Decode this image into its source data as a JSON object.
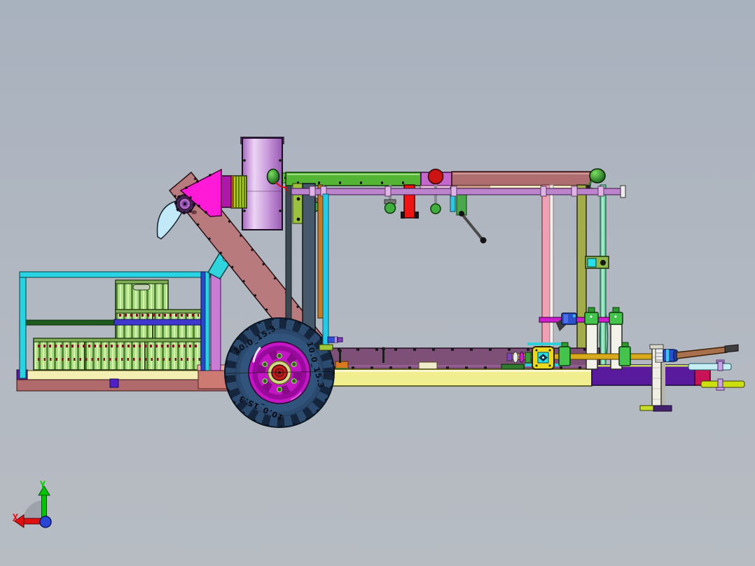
{
  "viewport": {
    "background_top": "#a8b1be",
    "background_mid": "#b2b8c1",
    "background_bottom": "#b7bcc3"
  },
  "orientation_triad": {
    "x_label": "X",
    "y_label": "Y",
    "x_axis_color": "#e81212",
    "y_axis_color": "#00d400",
    "z_axis_color": "#2a46d4"
  },
  "wheel": {
    "tire_marking": "10.0_15.3"
  },
  "model": {
    "colors": {
      "tire": "#2b4a6e",
      "tread": "#15253c",
      "rim": "#c216c4",
      "hub_ring": "#d6d68c",
      "hub_red": "#c41f1f",
      "chassis_yellow": "#f0ee8e",
      "deck_mauve": "#7e5078",
      "drawbar_purple": "#5a1a9e",
      "crimson": "#c81456",
      "hitch_cyan": "#c4eef4",
      "hitch_green": "#ccdf10",
      "conveyor": "#b87a7c",
      "beam_green": "#54b434",
      "beam_rosy": "#ae6e70",
      "orchid": "#c468cc",
      "pulley_red": "#cc1414",
      "cone_magenta": "#ff1ad8",
      "feed_purple": "#b016aa",
      "ribbed_green": "#a8cc20",
      "blade_blue": "#c2e9f8",
      "brace_cyan": "#30d4dc",
      "crate_green": "#aede84",
      "cage_cyan": "#28d4e4",
      "rail_indigo": "#4038cc",
      "rail_green": "#1e5a1e",
      "deck_cream": "#f4efb4",
      "platform_rosy": "#b06a6c",
      "platform_salmon": "#cc7a72",
      "post_slate": "#46586a",
      "post_red": "#ee1414",
      "post_pink": "#f0a0b4",
      "post_olive": "#a2ac48",
      "post_teal": "#62d8a2",
      "post_orchid": "#c87cd4",
      "post_cyan": "#28c8e8",
      "post_orange": "#cc7820",
      "post_graphite": "#3a4650",
      "rod_violet": "#bc84cc",
      "rod_magenta": "#cc1ecc",
      "shaft_gold": "#d9a91c",
      "bearing_green": "#44c44c",
      "cylinder_white": "#f2f2ea",
      "gearbox_yellow": "#e8d820",
      "gearbox_cyan": "#28e0e8",
      "motor_blue": "#2b52cc",
      "pto_brown": "#a8704c",
      "jack_ivory": "#f0efe6",
      "jack_foot": "#45216e",
      "jack_base": "#c6dc26",
      "lamp_green": "#1a6b1a"
    }
  }
}
